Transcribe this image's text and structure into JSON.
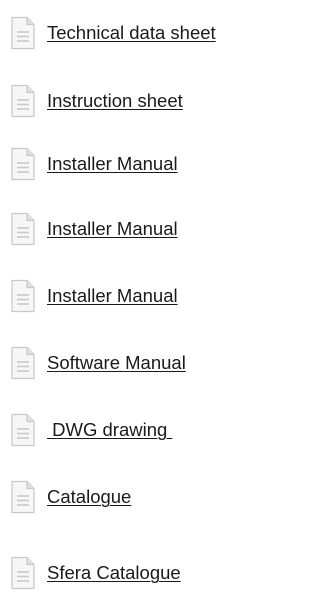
{
  "documents": [
    {
      "label": "Technical data sheet",
      "icon": "document-icon"
    },
    {
      "label": "Instruction sheet",
      "icon": "document-icon"
    },
    {
      "label": "Installer Manual",
      "icon": "document-icon"
    },
    {
      "label": "Installer Manual",
      "icon": "document-icon"
    },
    {
      "label": "Installer Manual",
      "icon": "document-icon"
    },
    {
      "label": "Software Manual",
      "icon": "document-icon"
    },
    {
      "label": " DWG drawing ",
      "icon": "document-icon"
    },
    {
      "label": "Catalogue",
      "icon": "document-icon"
    },
    {
      "label": "Sfera Catalogue",
      "icon": "document-icon"
    }
  ],
  "colors": {
    "link_text": "#1a1a1a",
    "icon_fill": "#f7f7f7",
    "icon_stroke": "#c8c8c8",
    "icon_fold": "#e2e2e2",
    "icon_lines": "#c8c8c8"
  }
}
